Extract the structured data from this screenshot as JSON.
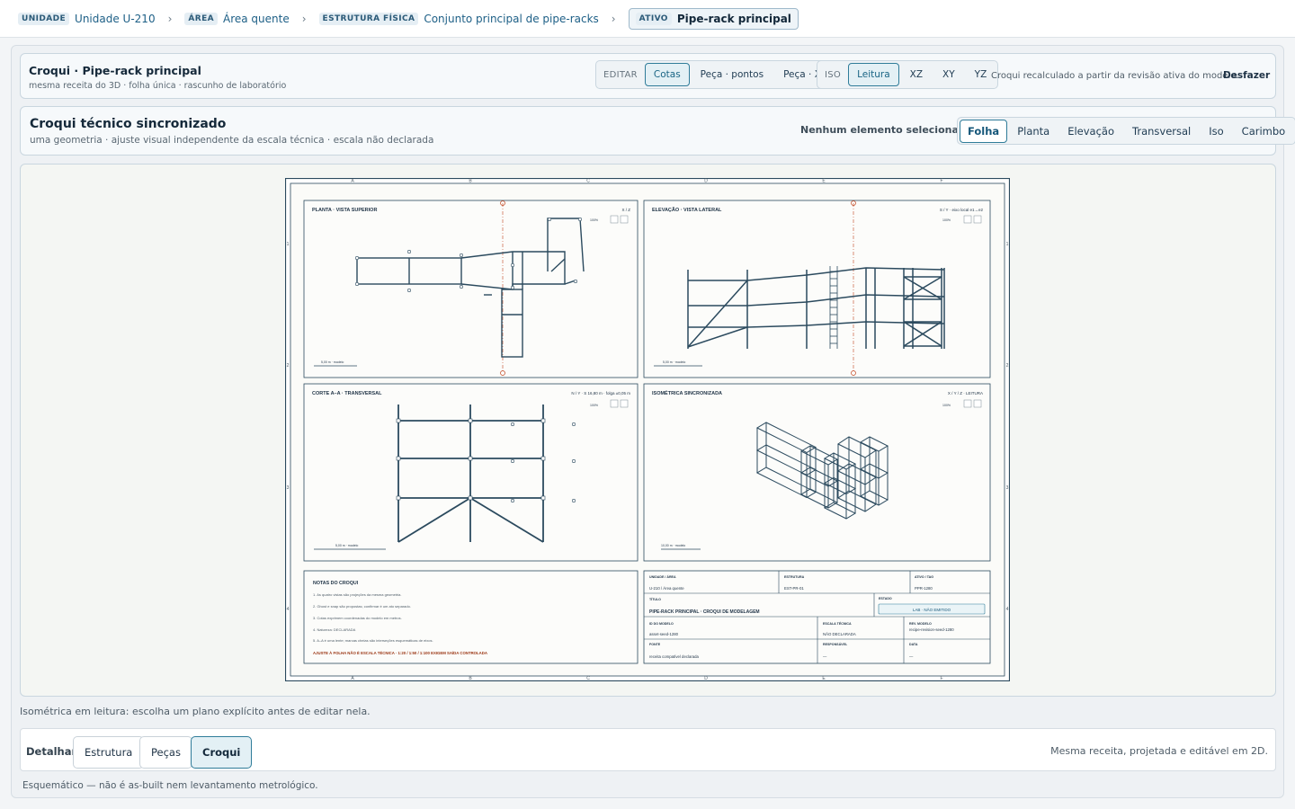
{
  "breadcrumb": [
    {
      "key": "UNIDADE",
      "value": "Unidade U-210"
    },
    {
      "key": "ÁREA",
      "value": "Área quente"
    },
    {
      "key": "ESTRUTURA FÍSICA",
      "value": "Conjunto principal de pipe-racks"
    },
    {
      "key": "ATIVO",
      "value": "Pipe-rack principal"
    }
  ],
  "header": {
    "title": "Croqui · Pipe-rack principal",
    "subtitle": "mesma receita do 3D · folha única · rascunho de laboratório",
    "edit_label": "EDITAR",
    "edit_options": [
      "Cotas",
      "Peça · pontos",
      "Peça · X"
    ],
    "iso_label": "ISO",
    "iso_options": [
      "Leitura",
      "XZ",
      "XY",
      "YZ"
    ],
    "note": "Croqui recalculado a partir da revisão ativa do modelo.",
    "undo": "Desfazer"
  },
  "sync": {
    "title": "Croqui técnico sincronizado",
    "subtitle": "uma geometria · ajuste visual independente da escala técnica · escala não declarada",
    "selection": "Nenhum elemento selecionado",
    "views": [
      "Folha",
      "Planta",
      "Elevação",
      "Transversal",
      "Iso",
      "Carimbo"
    ]
  },
  "sheet": {
    "col_letters": [
      "A",
      "B",
      "C",
      "D",
      "E",
      "F"
    ],
    "row_numbers": [
      "1",
      "2",
      "3",
      "4"
    ],
    "plan": {
      "title": "PLANTA · VISTA SUPERIOR",
      "axes": "X / Z",
      "zoom": "100%",
      "scale": "5,00 m · modelo"
    },
    "elev": {
      "title": "ELEVAÇÃO · VISTA LATERAL",
      "axes": "S / Y · eixo local e1→e2",
      "zoom": "100%",
      "scale": "5,00 m · modelo"
    },
    "cut": {
      "title": "CORTE A–A · TRANSVERSAL",
      "axes": "N / Y · S 16,80 m · folga ±0,05 m",
      "zoom": "100%",
      "scale": "5,00 m · modelo"
    },
    "iso": {
      "title": "ISOMÉTRICA SINCRONIZADA",
      "axes": "X / Y / Z · LEITURA",
      "zoom": "100%",
      "scale": "10,00 m · modelo"
    },
    "notes": {
      "title": "NOTAS DO CROQUI",
      "items": [
        "1. As quatro vistas são projeções da mesma geometria.",
        "2. Ghost e snap são propostas; confirmar é um ato separado.",
        "3. Cotas exprimem coordenadas do modelo em metros.",
        "4. Natureza: DECLARADA",
        "5. A–A é uma lente; marcas cheias são interseções esquemáticas de eixos."
      ],
      "warning": "AJUSTE À FOLHA NÃO É ESCALA TÉCNICA · 1:20 / 1:50 / 1:100 EXIGEM SAÍDA CONTROLADA"
    },
    "stamp": {
      "unit_label": "UNIDADE / ÁREA",
      "unit_value": "U-210 / Área quente",
      "structure_label": "ESTRUTURA",
      "structure_value": "EST-PR-01",
      "asset_label": "ATIVO / TAG",
      "asset_value": "PPR-1280",
      "title_label": "TÍTULO",
      "title_value": "PIPE-RACK PRINCIPAL · CROQUI DE MODELAGEM",
      "state_label": "ESTADO",
      "state_value": "LAB · NÃO EMITIDO",
      "model_id_label": "ID DO MODELO",
      "model_id_value": "asset-seed-1280",
      "scale_label": "ESCALA TÉCNICA",
      "scale_value": "NÃO DECLARADA",
      "rev_label": "REV. MODELO",
      "rev_value": "recipe-revision-seed-1280",
      "source_label": "FONTE",
      "source_value": "receita compatível declarada",
      "resp_label": "RESPONSÁVEL",
      "resp_value": "—",
      "date_label": "DATA",
      "date_value": "—"
    }
  },
  "hint": "Isométrica em leitura: escolha um plano explícito antes de editar nela.",
  "detail": {
    "label": "Detalhar",
    "tabs": [
      "Estrutura",
      "Peças",
      "Croqui"
    ],
    "active": "Croqui",
    "right": "Mesma receita, projetada e editável em 2D."
  },
  "footer": "Esquemático — não é as-built nem levantamento metrológico.",
  "colors": {
    "accent": "#2f7c99",
    "steel": "#2b4a5e",
    "axis": "#c2451e",
    "warning": "#9a3412"
  }
}
